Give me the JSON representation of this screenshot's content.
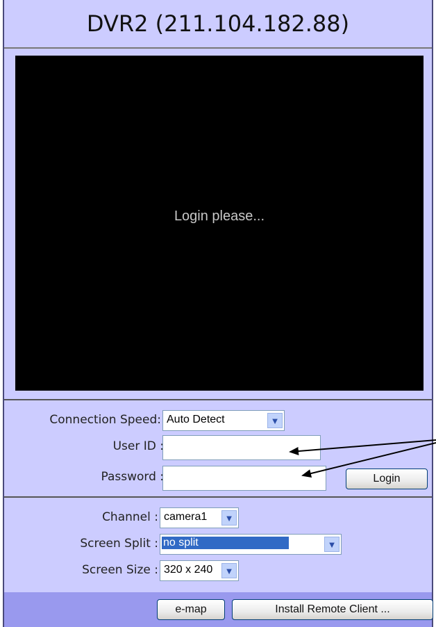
{
  "window": {
    "title": "DVR2 (211.104.182.88)"
  },
  "video": {
    "message": "Login please..."
  },
  "login": {
    "connection_speed_label": "Connection Speed:",
    "connection_speed_value": "Auto Detect",
    "user_id_label": "User ID :",
    "user_id_value": "",
    "password_label": "Password :",
    "password_value": "",
    "login_button": "Login"
  },
  "view": {
    "channel_label": "Channel :",
    "channel_value": "camera1",
    "split_label": "Screen Split :",
    "split_value": "no split",
    "size_label": "Screen Size :",
    "size_value": "320 x 240"
  },
  "footer": {
    "emap_button": "e-map",
    "install_button": "Install Remote Client ..."
  },
  "colors": {
    "panel": "#ccccff",
    "footer": "#9999ee",
    "selection": "#316ac5"
  }
}
